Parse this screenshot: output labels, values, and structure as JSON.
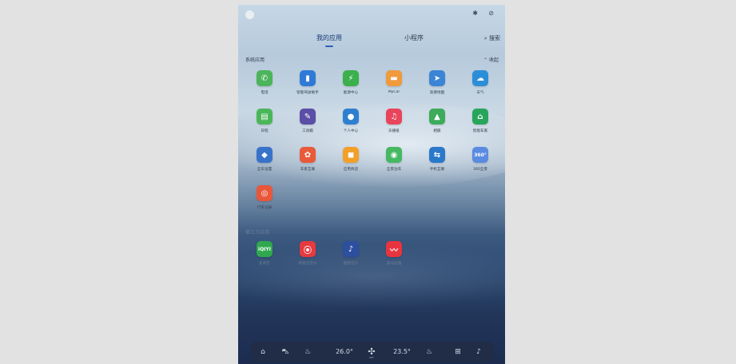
{
  "status_bar": {
    "icons": [
      "avatar-icon",
      "bluetooth-icon",
      "link-icon"
    ]
  },
  "tabs": [
    {
      "label": "我的应用",
      "active": true
    },
    {
      "label": "小程序",
      "active": false
    }
  ],
  "search": {
    "label": "搜索"
  },
  "sections": {
    "system": "系统应用",
    "thirdparty": "第三方应用",
    "collapse": "收起"
  },
  "system_apps": [
    {
      "label": "电话",
      "color": "#4cb45a",
      "glyph": "✆"
    },
    {
      "label": "智能驾驶助手",
      "color": "#2f7ad7",
      "glyph": "▮"
    },
    {
      "label": "能源中心",
      "color": "#3bb04d",
      "glyph": "⚡"
    },
    {
      "label": "MyCar",
      "color": "#f09a3c",
      "glyph": "▬"
    },
    {
      "label": "高德地图",
      "color": "#3b84d6",
      "glyph": "➤"
    },
    {
      "label": "天气",
      "color": "#2d8ed8",
      "glyph": "☁"
    },
    {
      "label": "日程",
      "color": "#4ab65a",
      "glyph": "▤"
    },
    {
      "label": "工具箱",
      "color": "#5b4ea6",
      "glyph": "✎"
    },
    {
      "label": "个人中心",
      "color": "#2e7fd0",
      "glyph": "●"
    },
    {
      "label": "乐播投",
      "color": "#e8455c",
      "glyph": "♫"
    },
    {
      "label": "相册",
      "color": "#3cab5a",
      "glyph": "▲"
    },
    {
      "label": "智能车家",
      "color": "#27a55a",
      "glyph": "⌂"
    },
    {
      "label": "全车设置",
      "color": "#3873c9",
      "glyph": "◆"
    },
    {
      "label": "车家互联",
      "color": "#e85a3a",
      "glyph": "✿"
    },
    {
      "label": "应用商店",
      "color": "#f2a02a",
      "glyph": "◼"
    },
    {
      "label": "全景泊车",
      "color": "#45b863",
      "glyph": "◉"
    },
    {
      "label": "手机互联",
      "color": "#2a78c9",
      "glyph": "⇆"
    },
    {
      "label": "360全景",
      "color": "#5a8be0",
      "glyph": "360°"
    },
    {
      "label": "行车记录",
      "color": "#e8573a",
      "glyph": "◎"
    }
  ],
  "third_apps": [
    {
      "label": "爱奇艺",
      "color": "#2fa84e",
      "glyph": "iQIYI"
    },
    {
      "label": "网易云音乐",
      "color": "#e63a3f",
      "glyph": "⦿"
    },
    {
      "label": "酷我音乐",
      "color": "#2d4fa0",
      "glyph": "♪"
    },
    {
      "label": "喜马拉雅",
      "color": "#e8343f",
      "glyph": "〰"
    }
  ],
  "dock": {
    "temp_left": "26.0°",
    "temp_right": "23.5°",
    "fan_label": "OFF",
    "icons": [
      "home-icon",
      "car-icon",
      "seat-heat-icon",
      "fan-icon",
      "seat-heat-right-icon",
      "apps-grid-icon",
      "music-icon"
    ]
  }
}
